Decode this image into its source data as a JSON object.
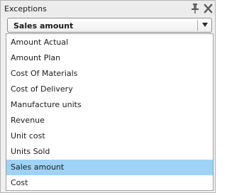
{
  "panel": {
    "title": "Exceptions",
    "pin_icon": "pin-icon",
    "close_icon": "close-icon"
  },
  "dropdown": {
    "selected_value": "Sales amount",
    "arrow_icon": "triangle-down-icon",
    "options": [
      "Amount Actual",
      "Amount Plan",
      "Cost Of Materials",
      "Cost of Delivery",
      "Manufacture units",
      "Revenue",
      "Unit cost",
      "Units Sold",
      "Sales amount",
      "Cost"
    ],
    "highlighted_option": "Sales amount"
  },
  "colors": {
    "highlight": "#9ed2f6",
    "panel_background": "#f0f0f0",
    "border": "#a0a0a0"
  }
}
